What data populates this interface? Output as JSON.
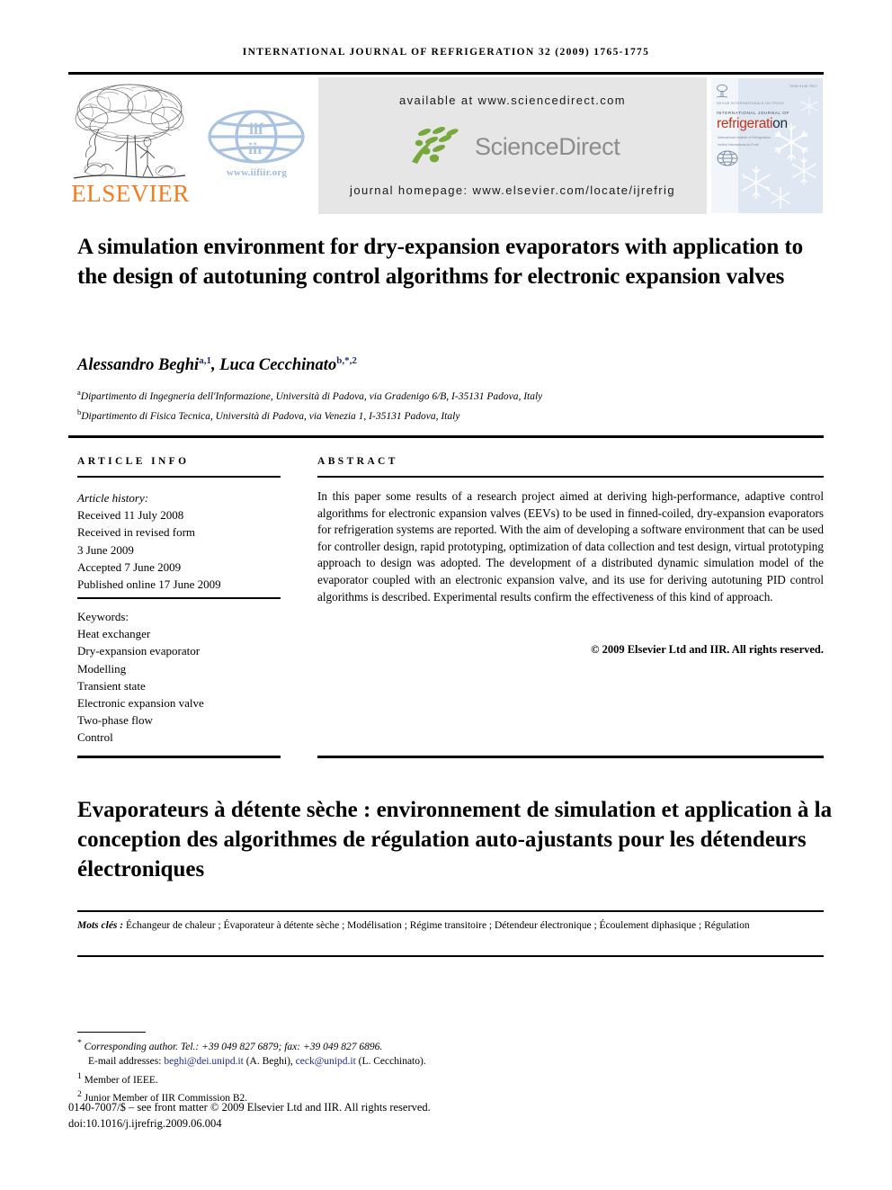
{
  "running_head": "INTERNATIONAL JOURNAL OF REFRIGERATION 32 (2009) 1765-1775",
  "header": {
    "elsevier_wordmark": "ELSEVIER",
    "elsevier_color": "#F47C20",
    "iif_url": "www.iifiir.org",
    "iif_logo_color": "#A9C3E0",
    "sciencedirect": {
      "available_at": "available at www.sciencedirect.com",
      "logo_text": "ScienceDirect",
      "logo_leaf_color": "#76A83C",
      "logo_text_color": "#8C8C8C",
      "journal_homepage": "journal homepage: www.elsevier.com/locate/ijrefrig",
      "band_color": "#E6E6E6"
    },
    "cover": {
      "top_right_code": "ISSN 0140-7007",
      "iir_line": "REVUE INTERNATIONALE DU FROID",
      "ijr_line": "INTERNATIONAL JOURNAL OF",
      "title": "refrigeration",
      "sub_line_1": "International Institute of Refrigeration",
      "sub_line_2": "Institut International du Froid",
      "background_color": "#DFE8F2"
    }
  },
  "article": {
    "title": "A simulation environment for dry-expansion evaporators with application to the design of autotuning control algorithms for electronic expansion valves",
    "authors_html": "Alessandro Beghi<sup>a,1</sup>, Luca Cecchinato<sup>b,*,2</sup>",
    "affiliations": [
      "Dipartimento di Ingegneria dell'Informazione, Università di Padova, via Gradenigo 6/B, I-35131 Padova, Italy",
      "Dipartimento di Fisica Tecnica, Università di Padova, via Venezia 1, I-35131 Padova, Italy"
    ],
    "affiliation_marks": [
      "a",
      "b"
    ]
  },
  "article_info": {
    "heading": "ARTICLE INFO",
    "history_label": "Article history:",
    "history": [
      "Received 11 July 2008",
      "Received in revised form",
      "3 June 2009",
      "Accepted 7 June 2009",
      "Published online 17 June 2009"
    ],
    "keywords_label": "Keywords:",
    "keywords": [
      "Heat exchanger",
      "Dry-expansion evaporator",
      "Modelling",
      "Transient state",
      "Electronic expansion valve",
      "Two-phase flow",
      "Control"
    ]
  },
  "abstract": {
    "heading": "ABSTRACT",
    "text": "In this paper some results of a research project aimed at deriving high-performance, adaptive control algorithms for electronic expansion valves (EEVs) to be used in finned-coiled, dry-expansion evaporators for refrigeration systems are reported. With the aim of developing a software environment that can be used for controller design, rapid prototyping, optimization of data collection and test design, virtual prototyping approach to design was adopted. The development of a distributed dynamic simulation model of the evaporator coupled with an electronic expansion valve, and its use for deriving autotuning PID control algorithms is described. Experimental results confirm the effectiveness of this kind of approach.",
    "copyright": "© 2009 Elsevier Ltd and IIR. All rights reserved."
  },
  "french": {
    "title": "Evaporateurs à détente sèche : environnement de simulation et application à la conception des algorithmes de régulation auto-ajustants pour les détendeurs électroniques",
    "keywords_label": "Mots clés :",
    "keywords_text": "Échangeur de chaleur ; Évaporateur à détente sèche ; Modélisation ; Régime transitoire ; Détendeur électronique ; Écoulement diphasique ; Régulation"
  },
  "footnotes": {
    "corresponding_marker": "*",
    "corresponding_text": "Corresponding author. Tel.: +39 049 827 6879; fax: +39 049 827 6896.",
    "email_label": "E-mail addresses:",
    "email_1": "beghi@dei.unipd.it",
    "email_1_name": "(A. Beghi),",
    "email_2": "ceck@unipd.it",
    "email_2_name": "(L. Cecchinato).",
    "note_1_marker": "1",
    "note_1": "Member of IEEE.",
    "note_2_marker": "2",
    "note_2": "Junior Member of IIR Commission B2.",
    "link_color": "#1F2D8E",
    "issn_line": "0140-7007/$ – see front matter © 2009 Elsevier Ltd and IIR. All rights reserved.",
    "doi_line": "doi:10.1016/j.ijrefrig.2009.06.004"
  }
}
